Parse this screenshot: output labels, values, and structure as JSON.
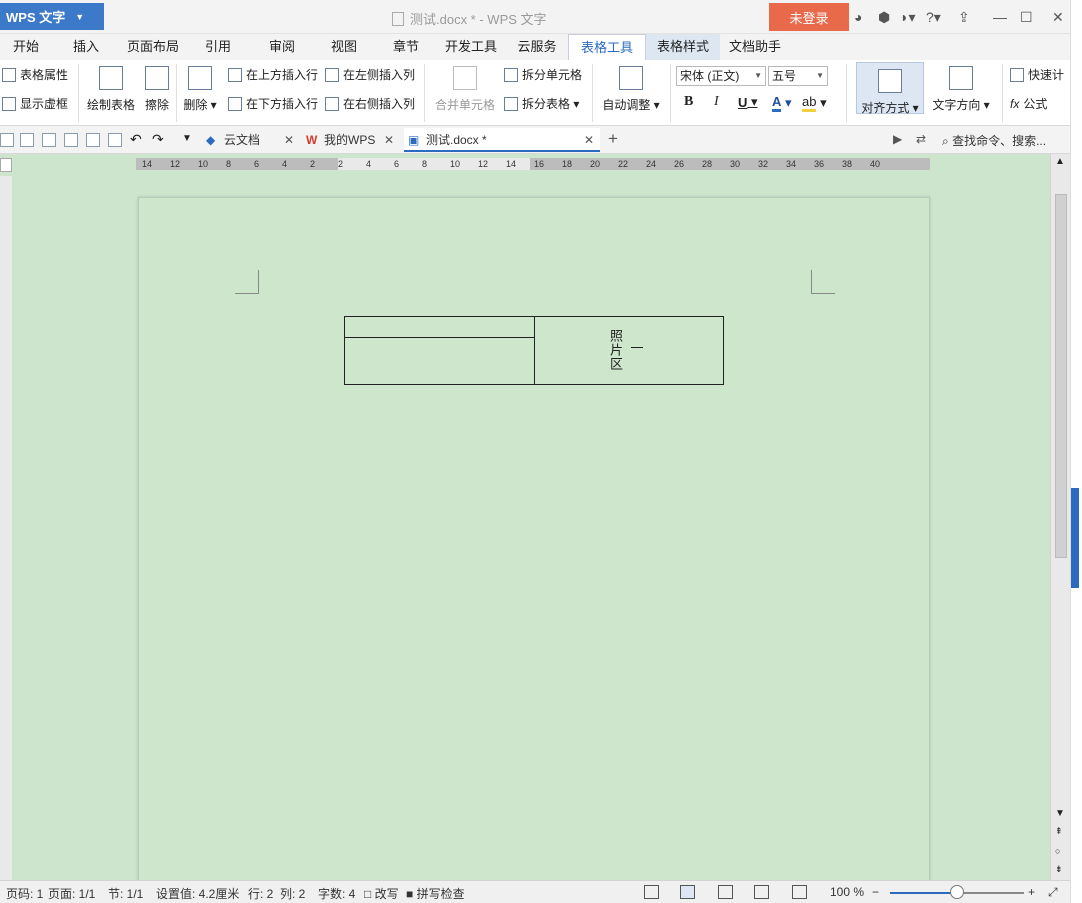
{
  "titlebar": {
    "app_name": "WPS 文字",
    "doc_title": "测试.docx * - WPS 文字",
    "login": "未登录"
  },
  "ribbon_tabs": [
    "开始",
    "插入",
    "页面布局",
    "引用",
    "审阅",
    "视图",
    "章节",
    "开发工具",
    "云服务",
    "表格工具",
    "表格样式",
    "文档助手"
  ],
  "ribbon": {
    "table_props": "表格属性",
    "show_gridlines": "显示虚框",
    "draw_table": "绘制表格",
    "erase": "擦除",
    "delete": "删除",
    "insert_above": "在上方插入行",
    "insert_below": "在下方插入行",
    "insert_left": "在左侧插入列",
    "insert_right": "在右侧插入列",
    "merge_cells": "合并单元格",
    "split_cells": "拆分单元格",
    "split_table": "拆分表格",
    "auto_fit": "自动调整",
    "font_name": "宋体 (正文)",
    "font_size": "五号",
    "bold": "B",
    "italic": "I",
    "underline": "U",
    "font_color": "A",
    "align": "对齐方式",
    "text_direction": "文字方向",
    "quick_calc": "快速计",
    "formula": "公式"
  },
  "doc_tabs": [
    {
      "label": "云文档"
    },
    {
      "label": "我的WPS"
    },
    {
      "label": "测试.docx *"
    }
  ],
  "search_cmd": "查找命令、搜索...",
  "ruler_h": [
    "14",
    "12",
    "10",
    "8",
    "6",
    "4",
    "2",
    "2",
    "4",
    "6",
    "8",
    "10",
    "12",
    "14",
    "16",
    "18",
    "20",
    "22",
    "24",
    "26",
    "28",
    "30",
    "32",
    "34",
    "36",
    "38",
    "40"
  ],
  "document": {
    "photo_label": "照片区",
    "cell_mark": "一"
  },
  "status": {
    "row_num": "页码: 1",
    "page": "页面: 1/1",
    "section": "节: 1/1",
    "setting": "设置值: 4.2厘米",
    "line": "行: 2",
    "col": "列: 2",
    "words": "字数: 4",
    "track": "改写",
    "spell": "拼写检查",
    "zoom": "100 %",
    "zoom_fraction": 0.5
  },
  "colors": {
    "accent": "#2b6bbf",
    "login_bg": "#e86a4b",
    "workspace_bg": "#cde4cd"
  }
}
